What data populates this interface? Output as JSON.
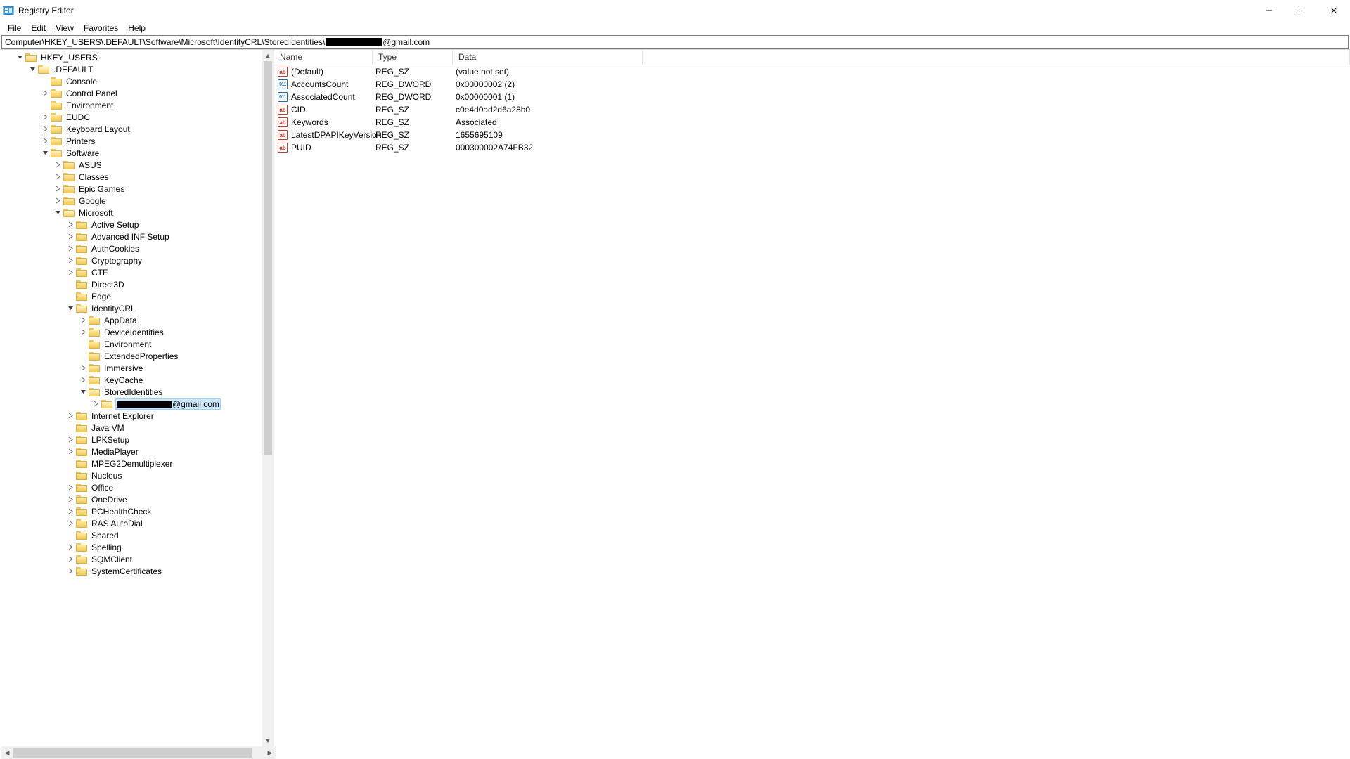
{
  "window": {
    "title": "Registry Editor"
  },
  "menu": {
    "file": "File",
    "edit": "Edit",
    "view": "View",
    "favorites": "Favorites",
    "help": "Help"
  },
  "address": {
    "prefix": "Computer\\HKEY_USERS\\.DEFAULT\\Software\\Microsoft\\IdentityCRL\\StoredIdentities\\",
    "suffix": "@gmail.com"
  },
  "tree": {
    "root": "HKEY_USERS",
    "default": ".DEFAULT",
    "console": "Console",
    "control_panel": "Control Panel",
    "environment": "Environment",
    "eudc": "EUDC",
    "keyboard_layout": "Keyboard Layout",
    "printers": "Printers",
    "software": "Software",
    "asus": "ASUS",
    "classes": "Classes",
    "epic": "Epic Games",
    "google": "Google",
    "microsoft": "Microsoft",
    "active_setup": "Active Setup",
    "adv_inf": "Advanced INF Setup",
    "authcookies": "AuthCookies",
    "cryptography": "Cryptography",
    "ctf": "CTF",
    "direct3d": "Direct3D",
    "edge": "Edge",
    "identitycrl": "IdentityCRL",
    "appdata": "AppData",
    "deviceidentities": "DeviceIdentities",
    "environment2": "Environment",
    "extendedprops": "ExtendedProperties",
    "immersive": "Immersive",
    "keycache": "KeyCache",
    "storedidentities": "StoredIdentities",
    "email_suffix": "@gmail.com",
    "ie": "Internet Explorer",
    "javavm": "Java VM",
    "lpksetup": "LPKSetup",
    "mediaplayer": "MediaPlayer",
    "mpeg2": "MPEG2Demultiplexer",
    "nucleus": "Nucleus",
    "office": "Office",
    "onedrive": "OneDrive",
    "pchealth": "PCHealthCheck",
    "ras": "RAS AutoDial",
    "shared": "Shared",
    "spelling": "Spelling",
    "sqmclient": "SQMClient",
    "syscerts": "SystemCertificates"
  },
  "columns": {
    "name": "Name",
    "type": "Type",
    "data": "Data"
  },
  "values": [
    {
      "icon": "str",
      "name": "(Default)",
      "type": "REG_SZ",
      "data": "(value not set)"
    },
    {
      "icon": "bin",
      "name": "AccountsCount",
      "type": "REG_DWORD",
      "data": "0x00000002 (2)"
    },
    {
      "icon": "bin",
      "name": "AssociatedCount",
      "type": "REG_DWORD",
      "data": "0x00000001 (1)"
    },
    {
      "icon": "str",
      "name": "CID",
      "type": "REG_SZ",
      "data": "c0e4d0ad2d6a28b0"
    },
    {
      "icon": "str",
      "name": "Keywords",
      "type": "REG_SZ",
      "data": "Associated"
    },
    {
      "icon": "str",
      "name": "LatestDPAPIKeyVersion",
      "type": "REG_SZ",
      "data": "1655695109"
    },
    {
      "icon": "str",
      "name": "PUID",
      "type": "REG_SZ",
      "data": "000300002A74FB32"
    }
  ]
}
